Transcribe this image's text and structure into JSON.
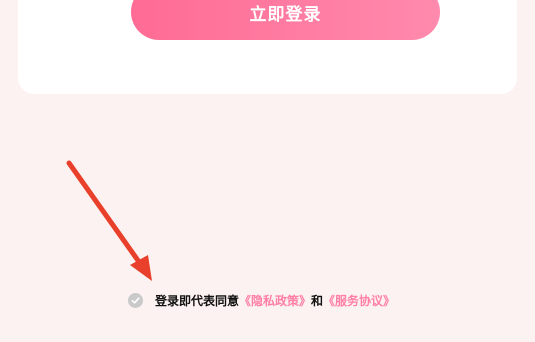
{
  "login": {
    "button_label": "立即登录"
  },
  "agreement": {
    "prefix": "登录即代表同意",
    "privacy_link": "《隐私政策》",
    "conjunction": "和",
    "terms_link": "《服务协议》",
    "checked": false
  },
  "colors": {
    "background": "#fdf2f2",
    "card": "#ffffff",
    "button_gradient_start": "#ff6b94",
    "button_gradient_end": "#ff8aad",
    "link": "#ff7fa6",
    "checkbox": "#c9c9c9",
    "arrow": "#e8402a"
  },
  "icons": {
    "checkbox": "check-circle-icon",
    "annotation": "arrow-icon"
  }
}
